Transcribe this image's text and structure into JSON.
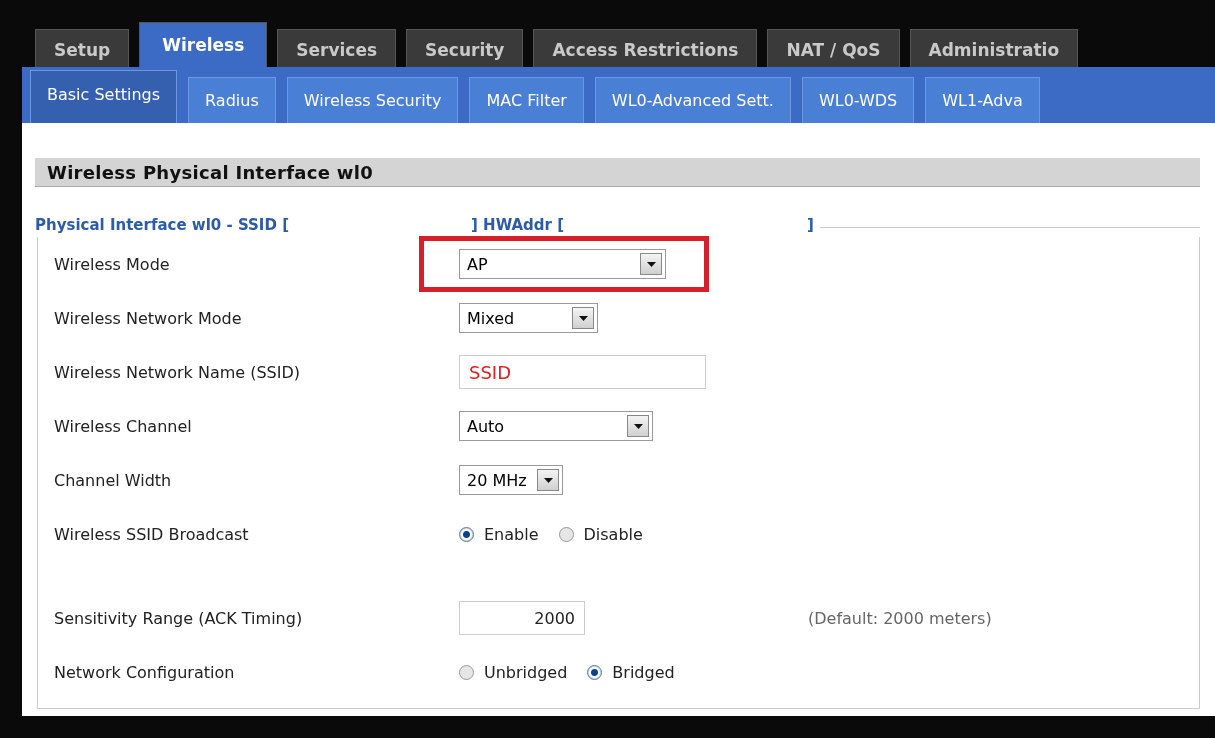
{
  "tabs": [
    {
      "label": "Setup",
      "selected": false
    },
    {
      "label": "Wireless",
      "selected": true
    },
    {
      "label": "Services",
      "selected": false
    },
    {
      "label": "Security",
      "selected": false
    },
    {
      "label": "Access Restrictions",
      "selected": false
    },
    {
      "label": "NAT / QoS",
      "selected": false
    },
    {
      "label": "Administratio",
      "selected": false
    }
  ],
  "subtabs": [
    {
      "label": "Basic Settings",
      "selected": true
    },
    {
      "label": "Radius",
      "selected": false
    },
    {
      "label": "Wireless Security",
      "selected": false
    },
    {
      "label": "MAC Filter",
      "selected": false
    },
    {
      "label": "WL0-Advanced Sett.",
      "selected": false
    },
    {
      "label": "WL0-WDS",
      "selected": false
    },
    {
      "label": "WL1-Adva",
      "selected": false
    }
  ],
  "section": {
    "title": "Wireless Physical Interface wl0",
    "legend_parts": [
      "Physical Interface wl0 - SSID [",
      "] HWAddr [",
      "]"
    ],
    "rows": [
      {
        "kind": "select",
        "label": "Wireless Mode",
        "value": "AP",
        "highlighted": true
      },
      {
        "kind": "select",
        "label": "Wireless Network Mode",
        "value": "Mixed",
        "highlighted": false
      },
      {
        "kind": "input",
        "label": "Wireless Network Name (SSID)",
        "value": "SSID"
      },
      {
        "kind": "select",
        "label": "Wireless Channel",
        "value": "Auto",
        "highlighted": false
      },
      {
        "kind": "select",
        "label": "Channel Width",
        "value": "20 MHz",
        "highlighted": false
      },
      {
        "kind": "radio",
        "label": "Wireless SSID Broadcast",
        "options": [
          {
            "label": "Enable",
            "selected": true
          },
          {
            "label": "Disable",
            "selected": false
          }
        ]
      },
      {
        "kind": "number",
        "label": "Sensitivity Range (ACK Timing)",
        "value": "2000",
        "note": "(Default: 2000 meters)"
      },
      {
        "kind": "radio",
        "label": "Network Configuration",
        "options": [
          {
            "label": "Unbridged",
            "selected": false
          },
          {
            "label": "Bridged",
            "selected": true
          }
        ]
      }
    ]
  }
}
